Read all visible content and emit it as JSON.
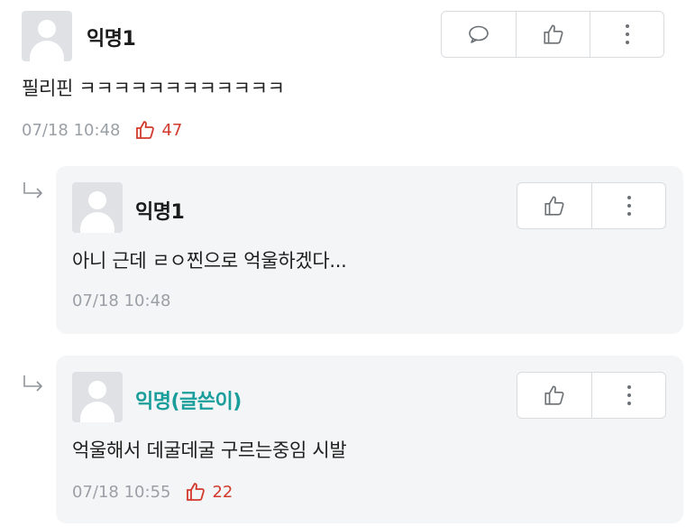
{
  "comments": [
    {
      "author": "익명1",
      "text": "필리핀 ㅋㅋㅋㅋㅋㅋㅋㅋㅋㅋㅋㅋ",
      "timestamp": "07/18 10:48",
      "likes": "47"
    }
  ],
  "replies": [
    {
      "author": "익명1",
      "text": "아니 근데 ㄹㅇ찐으로 억울하겠다...",
      "timestamp": "07/18 10:48"
    },
    {
      "author": "익명(글쓴이)",
      "text": "억울해서 데굴데굴 구르는중임 시발",
      "timestamp": "07/18 10:55",
      "likes": "22"
    }
  ],
  "icons": {
    "reply": "speech-bubble-icon",
    "like": "thumbs-up-icon",
    "more": "vertical-dots-icon",
    "reply_indicator": "reply-arrow-icon"
  },
  "colors": {
    "op_name": "#1a9e9b",
    "like_count": "#d23a2c",
    "meta": "#9aa0a6",
    "reply_bg": "#f4f5f6"
  }
}
